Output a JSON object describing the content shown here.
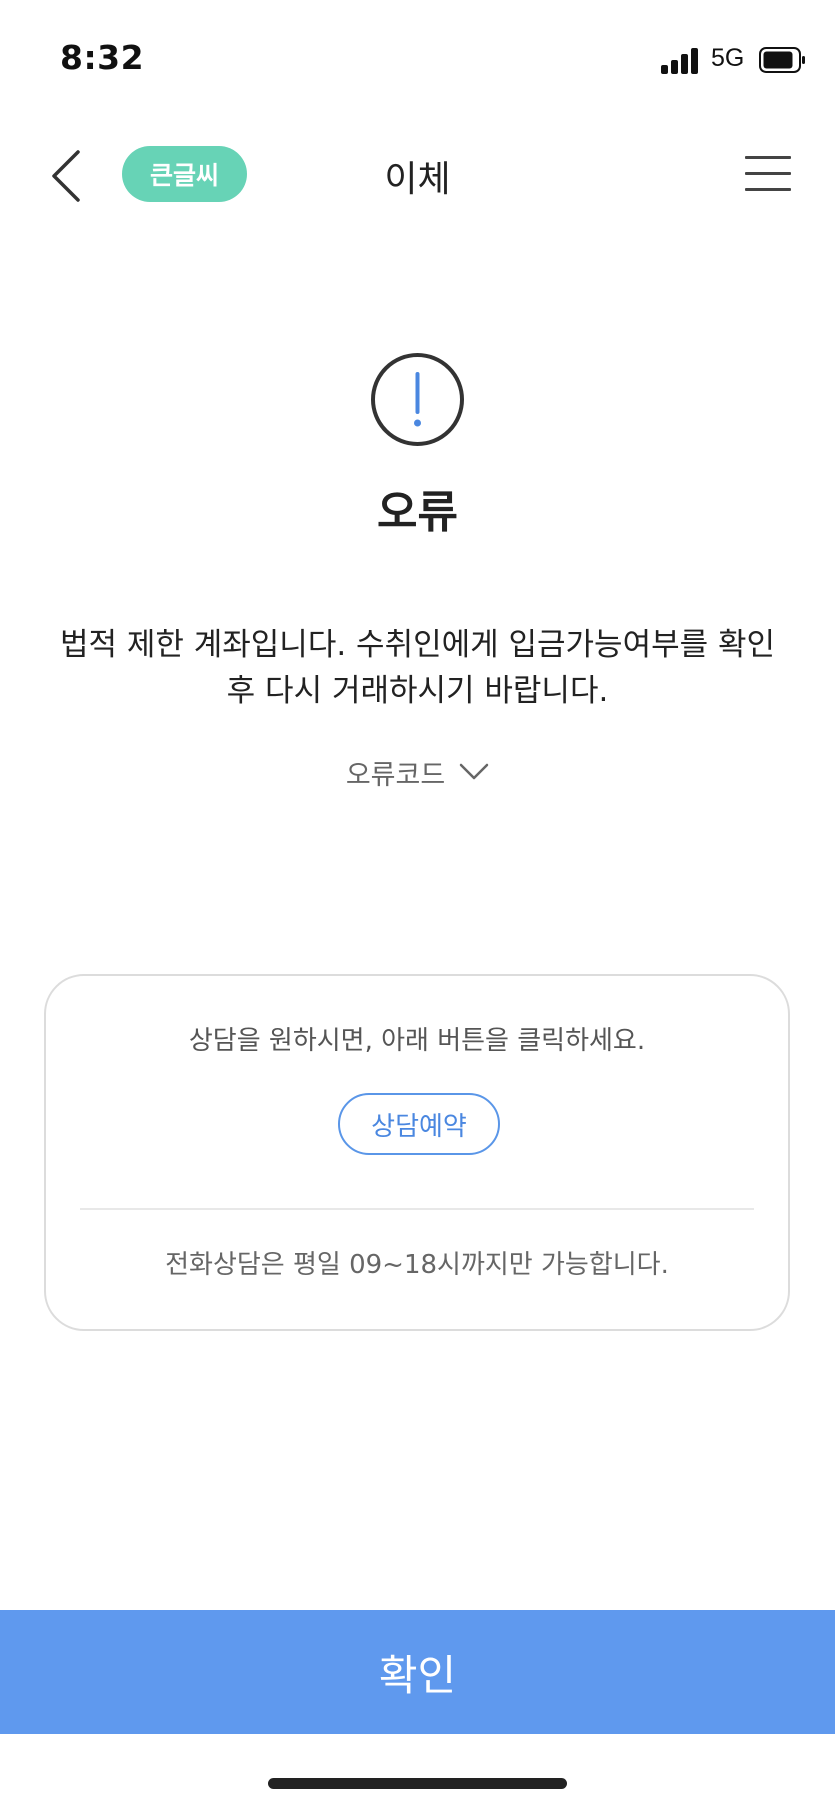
{
  "status_bar": {
    "time": "8:32",
    "network": "5G",
    "icons": [
      "signal-icon",
      "battery-icon"
    ]
  },
  "nav": {
    "back_icon": "chevron-left-icon",
    "large_text_toggle": "큰글씨",
    "title": "이체",
    "menu_icon": "hamburger-menu-icon"
  },
  "alert": {
    "icon": "exclamation-circle-icon",
    "title": "오류",
    "message_line1": "법적 제한 계좌입니다. 수취인에게 입금가능여부를 확인",
    "message_line2": "후 다시 거래하시기 바랍니다.",
    "error_code_label": "오류코드",
    "error_code_icon": "chevron-down-icon"
  },
  "consult": {
    "guide": "상담을 원하시면, 아래 버튼을 클릭하세요.",
    "reserve_label": "상담예약",
    "phone_hours": "전화상담은 평일 09~18시까지만 가능합니다."
  },
  "footer": {
    "confirm_label": "확인"
  },
  "colors": {
    "accent": "#5f99ee",
    "toggle_green": "#67d3b6",
    "link_blue": "#4a87e0",
    "text": "#222222"
  }
}
